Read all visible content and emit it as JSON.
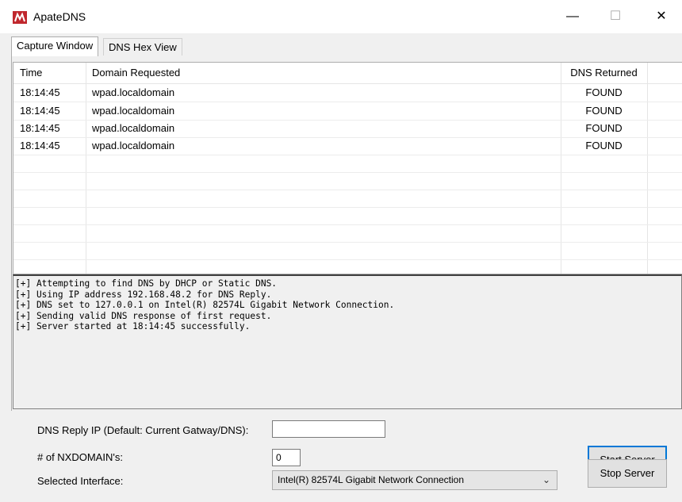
{
  "window": {
    "title": "ApateDNS",
    "minimize_glyph": "—",
    "maximize_glyph": "☐",
    "close_glyph": "✕"
  },
  "tabs": [
    {
      "label": "Capture Window",
      "active": true
    },
    {
      "label": "DNS Hex View",
      "active": false
    }
  ],
  "table": {
    "columns": [
      "Time",
      "Domain Requested",
      "DNS Returned"
    ],
    "rows": [
      {
        "time": "18:14:45",
        "domain": "wpad.localdomain",
        "dns": "FOUND"
      },
      {
        "time": "18:14:45",
        "domain": "wpad.localdomain",
        "dns": "FOUND"
      },
      {
        "time": "18:14:45",
        "domain": "wpad.localdomain",
        "dns": "FOUND"
      },
      {
        "time": "18:14:45",
        "domain": "wpad.localdomain",
        "dns": "FOUND"
      }
    ]
  },
  "log": [
    "[+] Attempting to find DNS by DHCP or Static DNS.",
    "[+] Using IP address 192.168.48.2 for DNS Reply.",
    "[+] DNS set to 127.0.0.1 on Intel(R) 82574L Gigabit Network Connection.",
    "[+] Sending valid DNS response of first request.",
    "[+] Server started at 18:14:45 successfully."
  ],
  "controls": {
    "reply_ip_label": "DNS Reply IP (Default: Current Gatway/DNS):",
    "reply_ip_value": "",
    "nxdomain_label": "# of NXDOMAIN's:",
    "nxdomain_value": "0",
    "interface_label": "Selected Interface:",
    "interface_value": "Intel(R) 82574L Gigabit Network Connection",
    "start_label": "Start Server",
    "stop_label": "Stop Server"
  },
  "colors": {
    "brand": "#c0272d",
    "focus": "#0078d7"
  },
  "icons": {
    "app": "apatedns-logo-icon",
    "dropdown": "chevron-down-icon"
  }
}
